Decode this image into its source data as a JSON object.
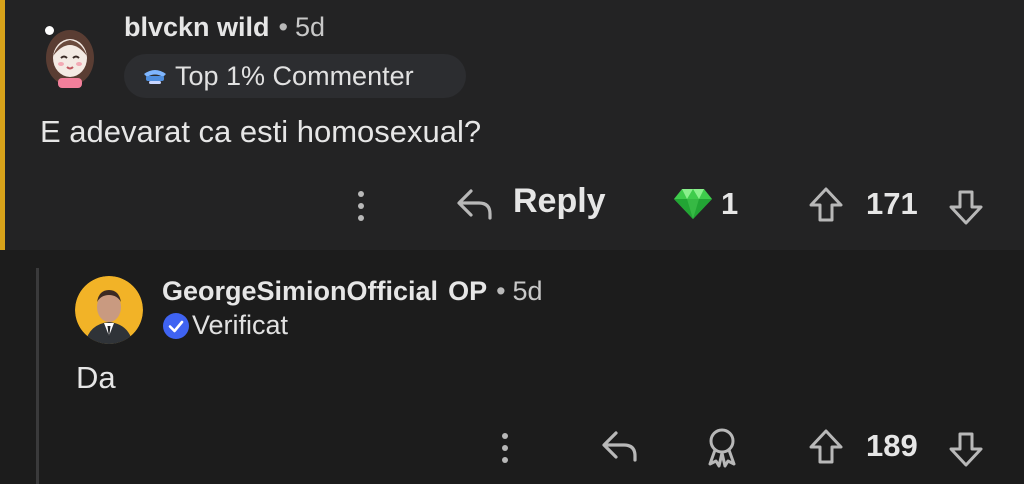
{
  "comment": {
    "username": "blvckn wild",
    "age": "5d",
    "flair": "Top 1% Commenter",
    "body": "E adevarat ca esti homosexual?",
    "reply_label": "Reply",
    "award_count": "1",
    "score": "171",
    "accent_color": "#d8a21a"
  },
  "reply": {
    "username": "GeorgeSimionOfficial",
    "op_badge": "OP",
    "age": "5d",
    "verified_label": "Verificat",
    "body": "Da",
    "score": "189"
  },
  "icons": {
    "more": "vertical-dots-icon",
    "reply": "reply-arrow-icon",
    "award": "award-icon",
    "diamond": "green-gem-icon",
    "upvote": "upvote-arrow-icon",
    "downvote": "downvote-arrow-icon",
    "verified": "verified-check-icon"
  }
}
